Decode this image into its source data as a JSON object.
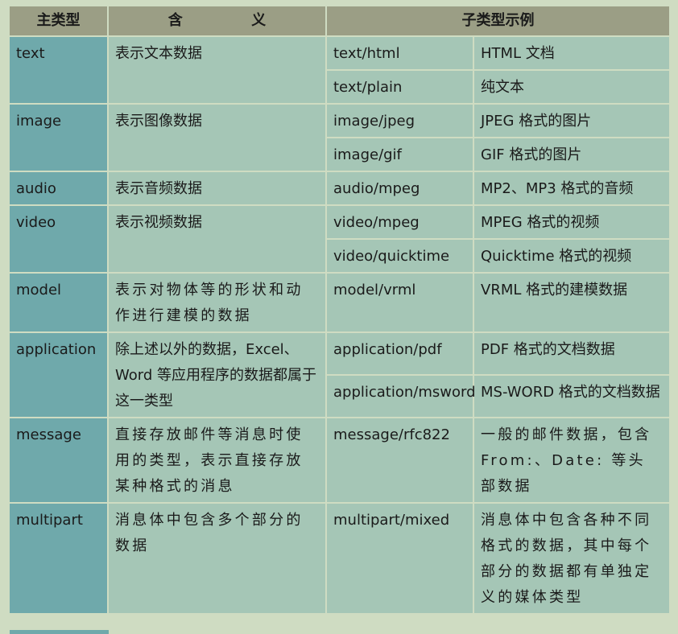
{
  "headers": {
    "main_type": "主类型",
    "meaning": "含 义",
    "subtype_example": "子类型示例"
  },
  "groups": [
    {
      "main": "text",
      "meaning": "表示文本数据",
      "subs": [
        {
          "subtype": "text/html",
          "desc": "HTML 文档"
        },
        {
          "subtype": "text/plain",
          "desc": "纯文本"
        }
      ]
    },
    {
      "main": "image",
      "meaning": "表示图像数据",
      "subs": [
        {
          "subtype": "image/jpeg",
          "desc": "JPEG 格式的图片"
        },
        {
          "subtype": "image/gif",
          "desc": "GIF 格式的图片"
        }
      ]
    },
    {
      "main": "audio",
      "meaning": "表示音频数据",
      "subs": [
        {
          "subtype": "audio/mpeg",
          "desc": "MP2、MP3 格式的音频"
        }
      ]
    },
    {
      "main": "video",
      "meaning": "表示视频数据",
      "subs": [
        {
          "subtype": "video/mpeg",
          "desc": "MPEG 格式的视频"
        },
        {
          "subtype": "video/quicktime",
          "desc": "Quicktime 格式的视频"
        }
      ]
    },
    {
      "main": "model",
      "meaning": "表示对物体等的形状和动作进行建模的数据",
      "subs": [
        {
          "subtype": "model/vrml",
          "desc": "VRML 格式的建模数据"
        }
      ]
    },
    {
      "main": "application",
      "meaning": "除上述以外的数据，Excel、Word 等应用程序的数据都属于这一类型",
      "subs": [
        {
          "subtype": "application/pdf",
          "desc": "PDF 格式的文档数据"
        },
        {
          "subtype": "application/msword",
          "desc": "MS-WORD 格式的文档数据"
        }
      ]
    },
    {
      "main": "message",
      "meaning": "直接存放邮件等消息时使用的类型，表示直接存放某种格式的消息",
      "subs": [
        {
          "subtype": "message/rfc822",
          "desc": "一般的邮件数据，包含 From:、Date: 等头部数据"
        }
      ]
    },
    {
      "main": "multipart",
      "meaning": "消息体中包含多个部分的数据",
      "subs": [
        {
          "subtype": "multipart/mixed",
          "desc": "消息体中包含各种不同格式的数据，其中每个部分的数据都有单独定义的媒体类型"
        }
      ]
    }
  ]
}
